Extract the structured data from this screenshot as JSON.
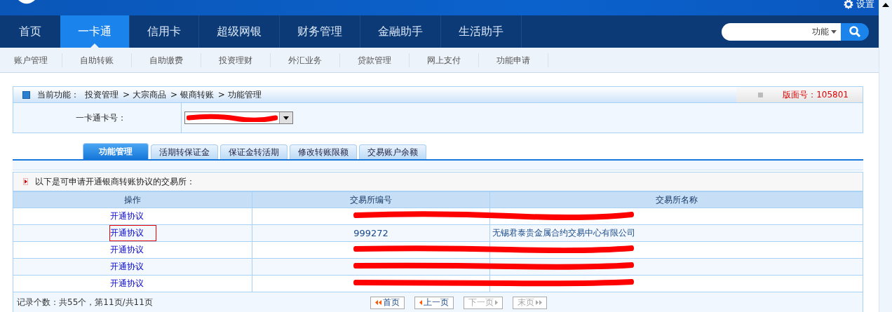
{
  "top_bar": {
    "settings": "设置"
  },
  "nav": [
    {
      "label": "首页",
      "selected": false
    },
    {
      "label": "一卡通",
      "selected": true
    },
    {
      "label": "信用卡",
      "selected": false
    },
    {
      "label": "超级网银",
      "selected": false
    },
    {
      "label": "财务管理",
      "selected": false
    },
    {
      "label": "金融助手",
      "selected": false
    },
    {
      "label": "生活助手",
      "selected": false
    }
  ],
  "search": {
    "scope": "功能"
  },
  "subnav": [
    "账户管理",
    "自助转账",
    "自助缴费",
    "投资理财",
    "外汇业务",
    "贷款管理",
    "网上支付",
    "功能申请"
  ],
  "breadcrumb": {
    "label": "当前功能：",
    "path": [
      "投资管理",
      "> 大宗商品",
      "> 银商转账",
      "> 功能管理"
    ],
    "page_no": "版面号：105801"
  },
  "card_field": {
    "label": "一卡通卡号："
  },
  "tabs": [
    {
      "label": "功能管理",
      "selected": true
    },
    {
      "label": "活期转保证金",
      "selected": false
    },
    {
      "label": "保证金转活期",
      "selected": false
    },
    {
      "label": "修改转账限额",
      "selected": false
    },
    {
      "label": "交易账户余额",
      "selected": false
    }
  ],
  "notice": "以下是可申请开通银商转账协议的交易所：",
  "table": {
    "columns": [
      "操作",
      "交易所编号",
      "交易所名称"
    ],
    "rows": [
      {
        "action": "开通协议",
        "redacted": true,
        "outlined": false
      },
      {
        "action": "开通协议",
        "code": "999272",
        "name": "无锡君泰贵金属合约交易中心有限公司",
        "redacted": false,
        "outlined": true
      },
      {
        "action": "开通协议",
        "redacted": true,
        "outlined": false
      },
      {
        "action": "开通协议",
        "redacted": true,
        "outlined": false
      },
      {
        "action": "开通协议",
        "redacted": true,
        "outlined": false
      }
    ]
  },
  "footer": {
    "count": "记录个数：共55个，第11页/共11页",
    "pager": [
      {
        "label": "首页",
        "kind": "first",
        "disabled": false
      },
      {
        "label": "上一页",
        "kind": "prev",
        "disabled": false
      },
      {
        "label": "下一页",
        "kind": "next",
        "disabled": true
      },
      {
        "label": "末页",
        "kind": "last",
        "disabled": true
      }
    ]
  }
}
